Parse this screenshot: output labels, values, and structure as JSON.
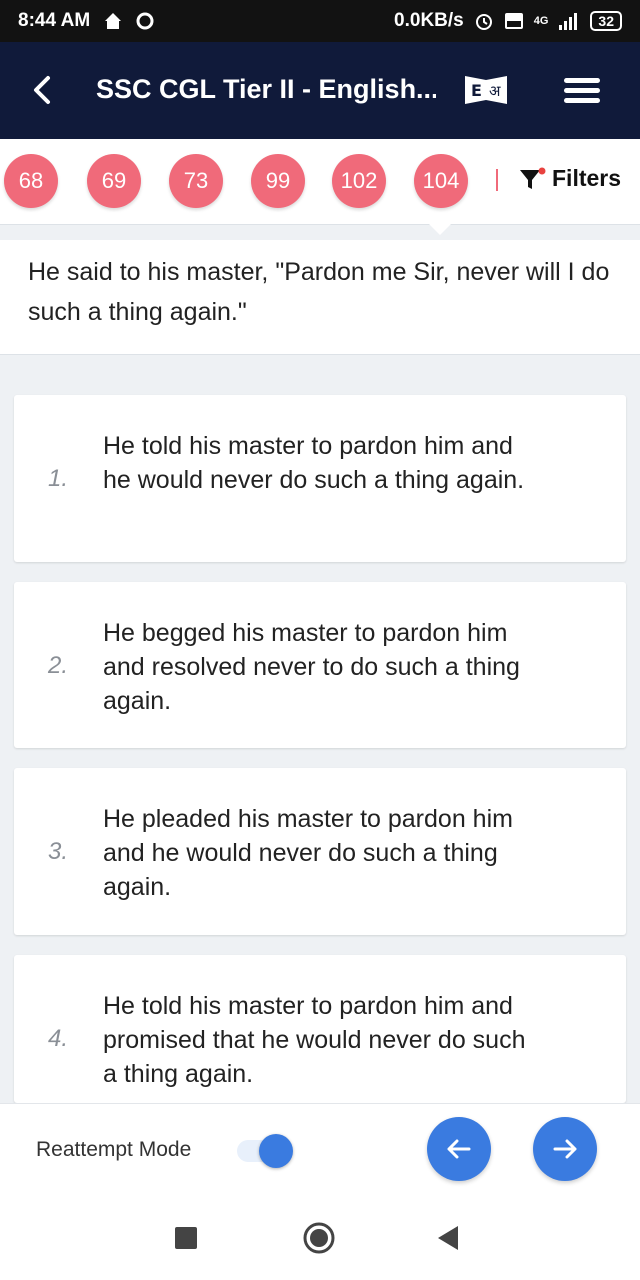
{
  "status": {
    "time": "8:44 AM",
    "speed": "0.0KB/s",
    "network": "4G",
    "battery": "32"
  },
  "appbar": {
    "title": "SSC CGL Tier II - English...",
    "lang_icon": "E अ"
  },
  "question_numbers": [
    "68",
    "69",
    "73",
    "99",
    "102",
    "104"
  ],
  "filters_label": "Filters",
  "question_text": "He said to his master, \"Pardon me Sir, never will I do such a thing again.\"",
  "options": [
    {
      "num": "1.",
      "text": "He told his master to pardon him and he would never do such a thing again."
    },
    {
      "num": "2.",
      "text": "He begged his master to pardon him and resolved never to do such a thing again."
    },
    {
      "num": "3.",
      "text": "He pleaded his master to pardon him and he would never do such a thing again."
    },
    {
      "num": "4.",
      "text": "He told his master to pardon him and promised that he would never do such a thing again."
    }
  ],
  "bottom": {
    "reattempt_label": "Reattempt Mode"
  },
  "colors": {
    "appbar": "#101a3a",
    "qnum": "#f06a7a",
    "accent": "#3a7be0"
  }
}
